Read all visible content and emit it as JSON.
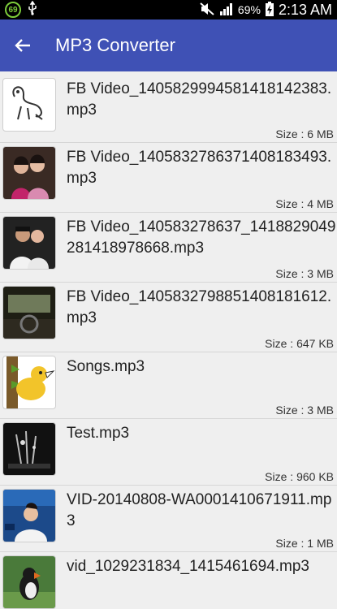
{
  "status_bar": {
    "badge": "69",
    "battery": "69%",
    "time": "2:13 AM"
  },
  "app_bar": {
    "title": "MP3 Converter"
  },
  "files": [
    {
      "name": "FB Video_140582999458141814​2383.mp3",
      "size": "Size : 6 MB",
      "thumb": "dinosaur-cartoon"
    },
    {
      "name": "FB Video_140583278637140818​3493.mp3",
      "size": "Size : 4 MB",
      "thumb": "two-women-photo"
    },
    {
      "name": "FB Video_140583278637_141882904​9281418978668.mp3",
      "size": "Size : 3 MB",
      "thumb": "man-and-woman-photo"
    },
    {
      "name": "FB Video_140583279885140818​1612.mp3",
      "size": "Size : 647 KB",
      "thumb": "car-interior-photo"
    },
    {
      "name": "Songs.mp3",
      "size": "Size : 3 MB",
      "thumb": "bird-cartoon"
    },
    {
      "name": "Test.mp3",
      "size": "Size : 960 KB",
      "thumb": "dark-scene"
    },
    {
      "name": "VID-20140808-WA0001410671911.mp3",
      "size": "Size : 1 MB",
      "thumb": "news-anchor-photo"
    },
    {
      "name": "vid_1029231834_1415461694.mp3",
      "size": "",
      "thumb": "puffin-photo"
    }
  ]
}
